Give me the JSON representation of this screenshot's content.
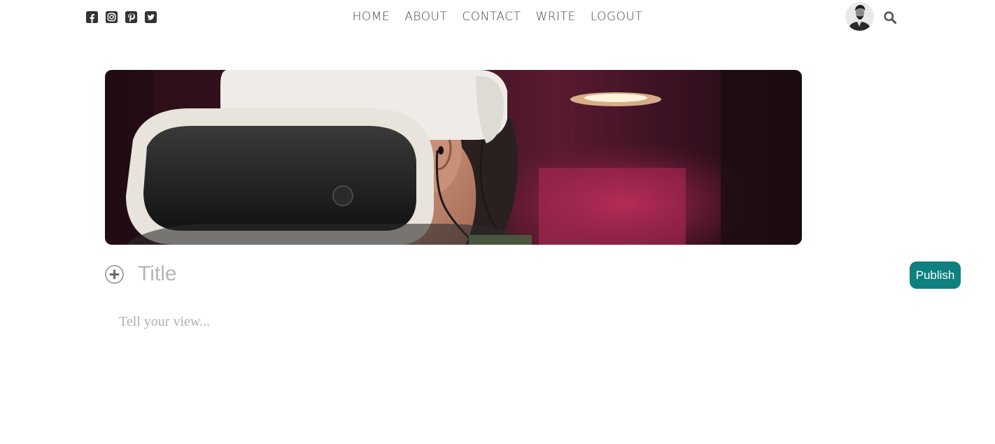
{
  "social": [
    {
      "icon": "facebook-square-icon"
    },
    {
      "icon": "instagram-square-icon"
    },
    {
      "icon": "pinterest-square-icon"
    },
    {
      "icon": "twitter-square-icon"
    }
  ],
  "nav": {
    "home": "HOME",
    "about": "ABOUT",
    "contact": "CONTACT",
    "write": "WRITE",
    "logout": "LOGOUT"
  },
  "header": {
    "avatar_icon": "user-avatar",
    "search_icon": "search-icon"
  },
  "editor": {
    "title_placeholder": "Title",
    "body_placeholder": "Tell your view...",
    "add_icon": "plus-circle-icon",
    "publish_label": "Publish"
  },
  "colors": {
    "accent": "#0e8080",
    "text": "#444444",
    "placeholder": "#b5b5b5"
  }
}
